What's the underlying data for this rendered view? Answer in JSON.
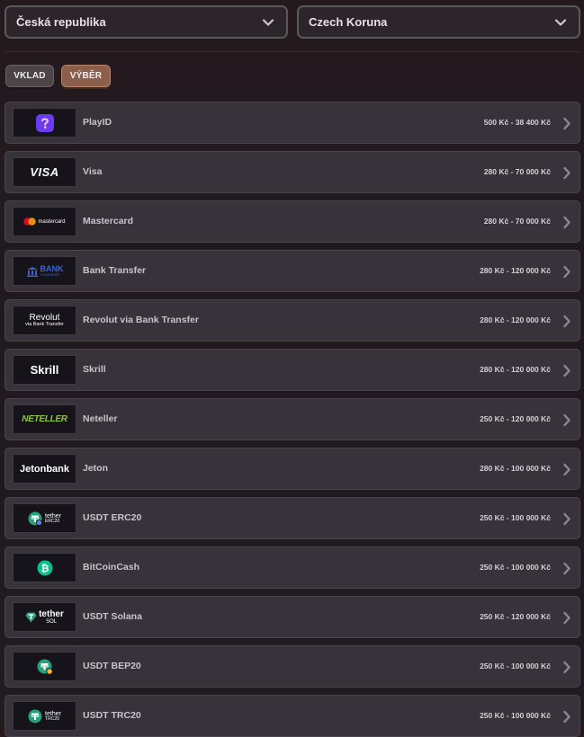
{
  "selectors": {
    "country": "Česká republika",
    "currency": "Czech Koruna"
  },
  "tabs": {
    "deposit": "VKLAD",
    "withdraw": "VÝBĚR"
  },
  "methods": [
    {
      "name": "PlayID",
      "range": "500 Kč - 38 400 Kč",
      "logo": "playid-icon"
    },
    {
      "name": "Visa",
      "range": "280 Kč - 70 000 Kč",
      "logo": "visa-logo",
      "logo_text": "VISA"
    },
    {
      "name": "Mastercard",
      "range": "280 Kč - 70 000 Kč",
      "logo": "mastercard-logo",
      "logo_text": "mastercard"
    },
    {
      "name": "Bank Transfer",
      "range": "280 Kč - 120 000 Kč",
      "logo": "bank-transfer-logo",
      "logo_text": "BANK",
      "logo_sub": "TRANSFER"
    },
    {
      "name": "Revolut via Bank Transfer",
      "range": "280 Kč - 120 000 Kč",
      "logo": "revolut-logo",
      "logo_text": "Revolut",
      "logo_sub": "via Bank Transfer"
    },
    {
      "name": "Skrill",
      "range": "280 Kč - 120 000 Kč",
      "logo": "skrill-logo",
      "logo_text": "Skrill"
    },
    {
      "name": "Neteller",
      "range": "250 Kč - 120 000 Kč",
      "logo": "neteller-logo",
      "logo_text": "NETELLER"
    },
    {
      "name": "Jeton",
      "range": "280 Kč - 100 000 Kč",
      "logo": "jetonbank-logo",
      "logo_text": "Jetonbank"
    },
    {
      "name": "USDT ERC20",
      "range": "250 Kč - 100 000 Kč",
      "logo": "tether-erc20-logo",
      "logo_text": "tether",
      "logo_sub": "ERC20"
    },
    {
      "name": "BitCoinCash",
      "range": "250 Kč - 100 000 Kč",
      "logo": "bitcoin-cash-icon"
    },
    {
      "name": "USDT Solana",
      "range": "250 Kč - 120 000 Kč",
      "logo": "tether-sol-logo",
      "logo_text": "tether",
      "logo_sub": "SOL"
    },
    {
      "name": "USDT BEP20",
      "range": "250 Kč - 100 000 Kč",
      "logo": "tether-bep20-icon"
    },
    {
      "name": "USDT TRC20",
      "range": "250 Kč - 100 000 Kč",
      "logo": "tether-trc20-logo",
      "logo_text": "tether",
      "logo_sub": "TRC20"
    }
  ],
  "colors": {
    "background": "#221b20",
    "row": "#38333a",
    "active_tab": "#8c5e4c",
    "playid": "#6a3cf0",
    "bank_blue": "#3b63d6",
    "neteller_green": "#8dc63f",
    "tether_green": "#26a17b",
    "bch_green": "#0ac18e"
  }
}
